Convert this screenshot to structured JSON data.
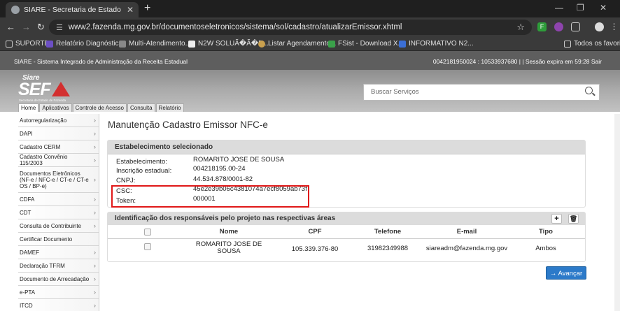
{
  "browser": {
    "tab_title": "SIARE - Secretaria de Estado d",
    "url": "www2.fazenda.mg.gov.br/documentoseletronicos/sistema/sol/cadastro/atualizarEmissor.xhtml",
    "bookmarks": [
      "SUPORTE",
      "Relatório Diagnóstic...",
      "Multi-Atendimento...",
      "N2W SOLUÃ�Ã�E...",
      "Listar Agendamento...",
      "FSist - Download X...",
      "INFORMATIVO N2...",
      "Todos os favoritos"
    ]
  },
  "header": {
    "system_name": "SIARE - Sistema Integrado de Administração da Receita Estadual",
    "session_info": "0042181950024 : 10533937680 | | Sessão expira em 59:28 Sair",
    "logo_top": "Siare",
    "logo_main": "SEF",
    "logo_sub": "Secretaria de Estado de Fazenda",
    "search_placeholder": "Buscar Serviços",
    "menu_tabs": [
      "Home",
      "Aplicativos",
      "Controle de Acesso",
      "Consulta",
      "Relatório"
    ]
  },
  "sidebar": {
    "items": [
      {
        "label": "Autorregularização"
      },
      {
        "label": "DAPI"
      },
      {
        "label": "Cadastro CERM"
      },
      {
        "label": "Cadastro Convênio 115/2003"
      },
      {
        "label": "Documentos Eletrônicos (NF-e / NFC-e / CT-e / CT-e OS / BP-e)"
      },
      {
        "label": "CDFA"
      },
      {
        "label": "CDT"
      },
      {
        "label": "Consulta de Contribuinte"
      },
      {
        "label": "Certificar Documento"
      },
      {
        "label": "DAMEF"
      },
      {
        "label": "Declaração TFRM"
      },
      {
        "label": "Documento de Arrecadação"
      },
      {
        "label": "e-PTA"
      },
      {
        "label": "ITCD"
      }
    ]
  },
  "main": {
    "title": "Manutenção Cadastro Emissor NFC-e",
    "establishment": {
      "heading": "Estabelecimento selecionado",
      "fields": [
        {
          "label": "Estabelecimento:",
          "value": "ROMARITO JOSE DE SOUSA"
        },
        {
          "label": "Inscrição estadual:",
          "value": "004218195.00-24"
        },
        {
          "label": "CNPJ:",
          "value": "44.534.878/0001-82"
        },
        {
          "label": "CSC:",
          "value": "45e2e39b06c4381074a7ecf8059ab73f"
        },
        {
          "label": "Token:",
          "value": "000001"
        }
      ]
    },
    "responsibles": {
      "heading": "Identificação dos responsáveis pelo projeto nas respectivas áreas",
      "columns": [
        "Nome",
        "CPF",
        "Telefone",
        "E-mail",
        "Tipo"
      ],
      "rows": [
        {
          "nome": "ROMARITO JOSE DE SOUSA",
          "cpf": "105.339.376-80",
          "telefone": "31982349988",
          "email": "siareadm@fazenda.mg.gov",
          "tipo": "Ambos"
        }
      ]
    },
    "advance_label": "Avançar"
  }
}
